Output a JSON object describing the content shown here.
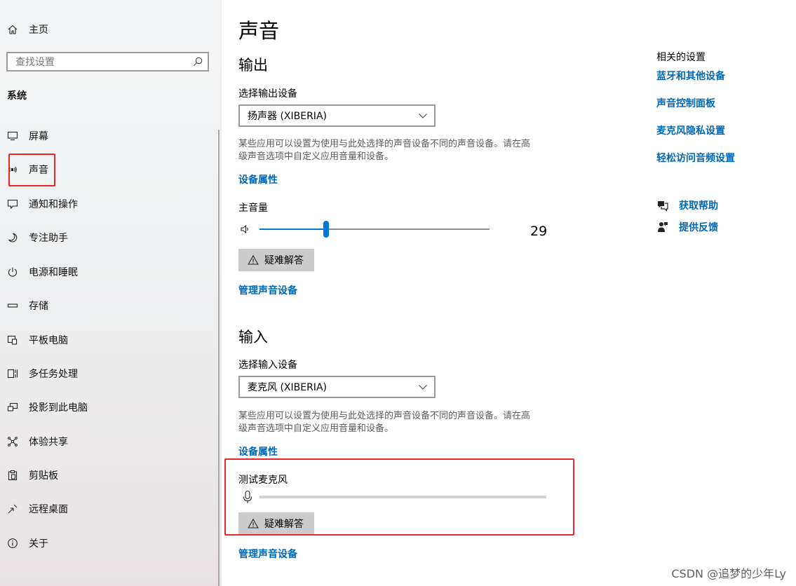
{
  "sidebar": {
    "home_label": "主页",
    "search_placeholder": "查找设置",
    "section_title": "系统",
    "items": [
      {
        "label": "屏幕",
        "icon": "monitor-icon"
      },
      {
        "label": "声音",
        "icon": "speaker-icon",
        "selected": true
      },
      {
        "label": "通知和操作",
        "icon": "notification-icon"
      },
      {
        "label": "专注助手",
        "icon": "moon-icon"
      },
      {
        "label": "电源和睡眠",
        "icon": "power-icon"
      },
      {
        "label": "存储",
        "icon": "storage-icon"
      },
      {
        "label": "平板电脑",
        "icon": "tablet-icon"
      },
      {
        "label": "多任务处理",
        "icon": "multitask-icon"
      },
      {
        "label": "投影到此电脑",
        "icon": "projection-icon"
      },
      {
        "label": "体验共享",
        "icon": "share-icon"
      },
      {
        "label": "剪贴板",
        "icon": "clipboard-icon"
      },
      {
        "label": "远程桌面",
        "icon": "remote-desktop-icon"
      },
      {
        "label": "关于",
        "icon": "info-icon"
      }
    ]
  },
  "main": {
    "title": "声音",
    "output": {
      "heading": "输出",
      "device_label": "选择输出设备",
      "device_value": "扬声器 (XIBERIA)",
      "description_line1": "某些应用可以设置为使用与此处选择的声音设备不同的声音设备。请在高",
      "description_line2": "级声音选项中自定义应用音量和设备。",
      "device_properties": "设备属性",
      "volume_label": "主音量",
      "volume_value": "29",
      "volume_fraction": 0.29,
      "troubleshoot": "疑难解答",
      "manage_devices": "管理声音设备"
    },
    "input": {
      "heading": "输入",
      "device_label": "选择输入设备",
      "device_value": "麦克风 (XIBERIA)",
      "description_line1": "某些应用可以设置为使用与此处选择的声音设备不同的声音设备。请在高",
      "description_line2": "级声音选项中自定义应用音量和设备。",
      "device_properties": "设备属性",
      "test_mic_label": "测试麦克风",
      "mic_level_fraction": 0,
      "troubleshoot": "疑难解答",
      "manage_devices": "管理声音设备"
    }
  },
  "related": {
    "title": "相关的设置",
    "links": [
      "蓝牙和其他设备",
      "声音控制面板",
      "麦克风隐私设置",
      "轻松访问音频设置"
    ],
    "get_help": "获取帮助",
    "feedback": "提供反馈"
  },
  "watermark": "CSDN @追梦的少年Ly",
  "colors": {
    "accent": "#0078d7",
    "link": "#0067b8",
    "highlight": "#e8262a"
  }
}
